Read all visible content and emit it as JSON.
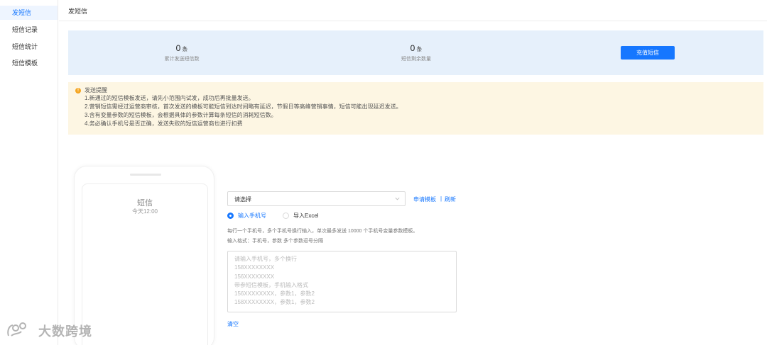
{
  "sidebar": {
    "items": [
      {
        "label": "发短信",
        "active": true
      },
      {
        "label": "短信记录",
        "active": false
      },
      {
        "label": "短信统计",
        "active": false
      },
      {
        "label": "短信模板",
        "active": false
      }
    ]
  },
  "header": {
    "title": "发短信"
  },
  "stats": {
    "sent": {
      "value": "0",
      "unit": "条",
      "label": "累计发送短信数"
    },
    "remaining": {
      "value": "0",
      "unit": "条",
      "label": "短信剩余数量"
    },
    "recharge_label": "充值短信"
  },
  "notice": {
    "title": "发送提醒",
    "lines": [
      "1.新通过的短信模板发送，请先小范围内试发，成功后再批量发送。",
      "2.营销短信需经过运营商审核，首次发送的模板可能短信到达时间略有延迟，节假日等高峰营销事情，短信可能出现延迟发送。",
      "3.含有变量参数的短信模板，会根据具体的参数计算每条短信的消耗短信数。",
      "4.务必确认手机号是否正确，发送失败的短信运营商也进行扣费"
    ]
  },
  "preview": {
    "title": "短信",
    "time": "今天12:00"
  },
  "form": {
    "template_placeholder": "请选择",
    "apply_template": "申请模板",
    "separator": "|",
    "refresh": "刷新",
    "radio_phone": "输入手机号",
    "radio_excel": "导入Excel",
    "hint_line1": "每行一个手机号，多个手机号换行输入，单次最多发送 10000 个手机号变量参数模板。",
    "hint_line2": "输入格式：手机号，参数 多个参数逗号分隔",
    "phones_placeholder_lines": [
      "请输入手机号，多个换行",
      "158XXXXXXXX",
      "156XXXXXXXX",
      "带参短信模板，手机输入格式",
      "156XXXXXXXX，参数1，参数2",
      "158XXXXXXXX，参数1，参数2"
    ],
    "clear_label": "清空"
  },
  "watermark": {
    "text": "大数跨境"
  },
  "colors": {
    "accent": "#1677ff",
    "stats_bg": "#e6f0fb",
    "notice_bg": "#fdf6e3",
    "warning": "#f5a623"
  }
}
